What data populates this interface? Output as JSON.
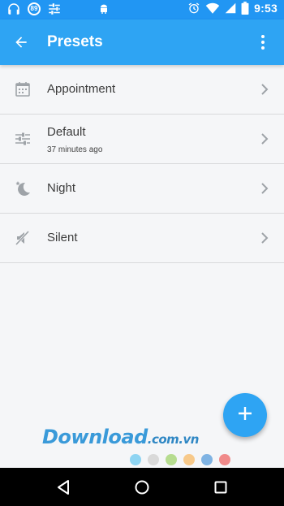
{
  "status_bar": {
    "notification_badge": "89",
    "time": "9:53",
    "icons": [
      "headphones-icon",
      "sliders-icon",
      "android-icon",
      "alarm-icon",
      "wifi-icon",
      "signal-icon",
      "battery-icon"
    ]
  },
  "app_bar": {
    "title": "Presets",
    "back_icon": "arrow-back-icon",
    "menu_icon": "more-vertical-icon",
    "color": "#2ea4f3"
  },
  "presets": [
    {
      "label": "Appointment",
      "subtitle": "",
      "icon": "calendar-icon"
    },
    {
      "label": "Default",
      "subtitle": "37 minutes ago",
      "icon": "sliders-icon"
    },
    {
      "label": "Night",
      "subtitle": "",
      "icon": "moon-icon"
    },
    {
      "label": "Silent",
      "subtitle": "",
      "icon": "muted-speaker-icon"
    }
  ],
  "fab": {
    "icon": "plus-icon",
    "color": "#2ea4f3"
  },
  "watermark": {
    "brand": "Download",
    "suffix": ".com.vn",
    "dot_colors": [
      "#8ed4f2",
      "#d9d9d9",
      "#b6dc8f",
      "#f7c98a",
      "#7fb3e3",
      "#f08a8a"
    ]
  },
  "nav_bar": {
    "icons": [
      "back-triangle-icon",
      "home-circle-icon",
      "recents-square-icon"
    ]
  }
}
